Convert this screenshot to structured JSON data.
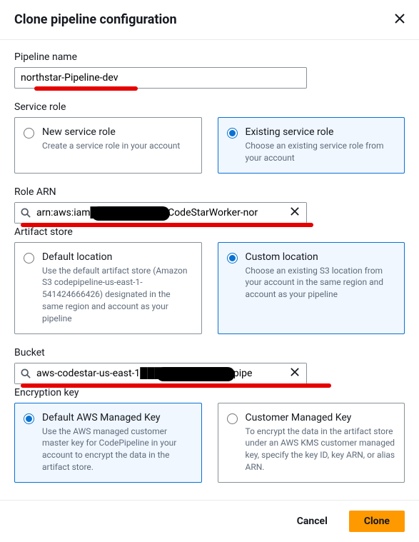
{
  "header": {
    "title": "Clone pipeline configuration"
  },
  "pipelineName": {
    "label": "Pipeline name",
    "value": "northstar-Pipeline-dev"
  },
  "serviceRole": {
    "label": "Service role",
    "options": {
      "new": {
        "title": "New service role",
        "desc": "Create a service role in your account"
      },
      "existing": {
        "title": "Existing service role",
        "desc": "Choose an existing service role from your account"
      }
    }
  },
  "roleArn": {
    "label": "Role ARN",
    "value": "arn:aws:iam████████role/CodeStarWorker-nor"
  },
  "artifactStore": {
    "label": "Artifact store",
    "options": {
      "default": {
        "title": "Default location",
        "desc": "Use the default artifact store (Amazon S3 codepipeline-us-east-1-541424666426) designated in the same region and account as your pipeline"
      },
      "custom": {
        "title": "Custom location",
        "desc": "Choose an existing S3 location from your account in the same region and account as your pipeline"
      }
    }
  },
  "bucket": {
    "label": "Bucket",
    "value": "aws-codestar-us-east-1███████northstar-pipe"
  },
  "encryptionKey": {
    "label": "Encryption key",
    "options": {
      "default": {
        "title": "Default AWS Managed Key",
        "desc": "Use the AWS managed customer master key for CodePipeline in your account to encrypt the data in the artifact store."
      },
      "customer": {
        "title": "Customer Managed Key",
        "desc": "To encrypt the data in the artifact store under an AWS KMS customer managed key, specify the key ID, key ARN, or alias ARN."
      }
    }
  },
  "footer": {
    "cancel": "Cancel",
    "clone": "Clone"
  }
}
